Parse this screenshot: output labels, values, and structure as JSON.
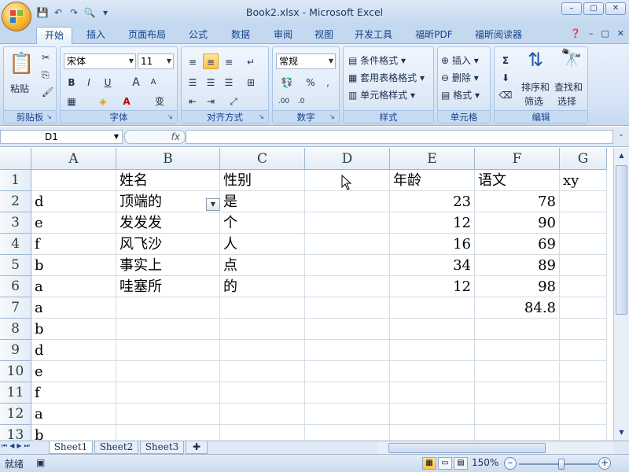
{
  "window": {
    "title": "Book2.xlsx - Microsoft Excel"
  },
  "tabs": [
    "开始",
    "插入",
    "页面布局",
    "公式",
    "数据",
    "审阅",
    "视图",
    "开发工具",
    "福昕PDF",
    "福昕阅读器"
  ],
  "active_tab": "开始",
  "ribbon": {
    "clipboard": {
      "label": "剪贴板",
      "paste": "粘贴"
    },
    "font": {
      "label": "字体",
      "font_name": "宋体",
      "font_size": "11",
      "bold": "B",
      "italic": "I",
      "underline": "U",
      "grow": "A",
      "shrink": "A",
      "phonetic": "变"
    },
    "alignment": {
      "label": "对齐方式"
    },
    "number": {
      "label": "数字",
      "format": "常规",
      "percent": "%",
      "comma": ","
    },
    "styles": {
      "label": "样式",
      "conditional": "条件格式",
      "table": "套用表格格式",
      "cell_styles": "单元格样式"
    },
    "cells": {
      "label": "单元格",
      "insert": "插入",
      "delete": "删除",
      "format": "格式"
    },
    "editing": {
      "label": "编辑",
      "sum": "Σ",
      "sort1": "排序和",
      "sort2": "筛选",
      "find1": "查找和",
      "find2": "选择"
    }
  },
  "formula_bar": {
    "name_box": "D1",
    "fx": "fx",
    "formula": ""
  },
  "columns": [
    "A",
    "B",
    "C",
    "D",
    "E",
    "F",
    "G"
  ],
  "rows": [
    [
      "",
      "姓名",
      "性别",
      "",
      "年龄",
      "语文",
      "xy"
    ],
    [
      "d",
      "顶端的",
      "是",
      "",
      "23",
      "78",
      ""
    ],
    [
      "e",
      "发发发",
      "个",
      "",
      "12",
      "90",
      ""
    ],
    [
      "f",
      "风飞沙",
      "人",
      "",
      "16",
      "69",
      ""
    ],
    [
      "b",
      "事实上",
      "点",
      "",
      "34",
      "89",
      ""
    ],
    [
      "a",
      "哇塞所",
      "的",
      "",
      "12",
      "98",
      ""
    ],
    [
      "a",
      "",
      "",
      "",
      "",
      "84.8",
      ""
    ],
    [
      "b",
      "",
      "",
      "",
      "",
      "",
      ""
    ],
    [
      "d",
      "",
      "",
      "",
      "",
      "",
      ""
    ],
    [
      "e",
      "",
      "",
      "",
      "",
      "",
      ""
    ],
    [
      "f",
      "",
      "",
      "",
      "",
      "",
      ""
    ],
    [
      "a",
      "",
      "",
      "",
      "",
      "",
      ""
    ],
    [
      "b",
      "",
      "",
      "",
      "",
      "",
      ""
    ]
  ],
  "sheets": [
    "Sheet1",
    "Sheet2",
    "Sheet3"
  ],
  "active_sheet": "Sheet1",
  "status": {
    "mode": "就绪",
    "zoom": "150%"
  }
}
